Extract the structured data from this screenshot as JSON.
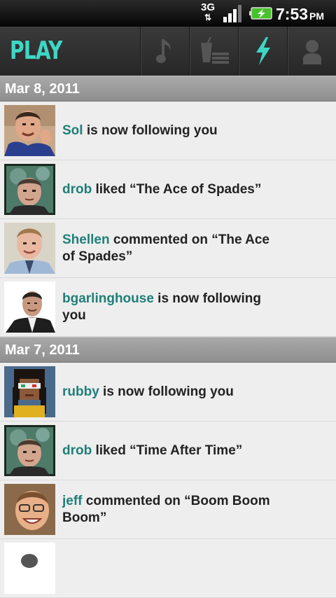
{
  "status_bar": {
    "network": "3G",
    "time": "7:53",
    "ampm": "PM",
    "icons": [
      "network-3g-icon",
      "signal-icon",
      "battery-charging-icon"
    ]
  },
  "toolbar": {
    "logo": "PLAY",
    "accent_color": "#3fd6c4",
    "tabs": [
      {
        "icon": "music-note-icon",
        "active": false
      },
      {
        "icon": "drink-queue-icon",
        "active": false
      },
      {
        "icon": "lightning-icon",
        "active": true
      },
      {
        "icon": "user-profile-icon",
        "active": false
      }
    ]
  },
  "feed": {
    "username_color": "#1f7f78",
    "sections": [
      {
        "date": "Mar 8, 2011",
        "items": [
          {
            "user": "Sol",
            "action": " is now following you"
          },
          {
            "user": "drob",
            "action": " liked “The Ace of Spades”"
          },
          {
            "user": "Shellen",
            "action": " commented on “The Ace of Spades”"
          },
          {
            "user": "bgarlinghouse",
            "action": " is now following you"
          }
        ]
      },
      {
        "date": "Mar 7, 2011",
        "items": [
          {
            "user": "rubby",
            "action": " is now following you"
          },
          {
            "user": "drob",
            "action": " liked “Time After Time”"
          },
          {
            "user": "jeff",
            "action": " commented on “Boom Boom Boom”"
          },
          {
            "user": "",
            "action": ""
          }
        ]
      }
    ]
  }
}
